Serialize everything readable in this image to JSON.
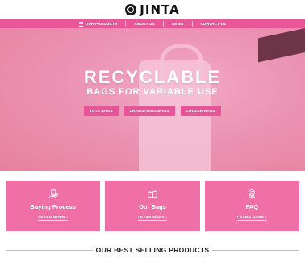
{
  "brand": {
    "logo_text": "JINTA"
  },
  "nav": {
    "items": [
      {
        "label": "OUR PRODUCTS"
      },
      {
        "label": "ABOUT US"
      },
      {
        "label": "NEWS"
      },
      {
        "label": "CONTACT US"
      }
    ]
  },
  "hero": {
    "title": "RECYCLABLE",
    "subtitle": "BAGS FOR VARIABLE USE",
    "buttons": [
      {
        "label": "TOTE BAGS"
      },
      {
        "label": "DRAWSTRING BAGS"
      },
      {
        "label": "COOLER BAGS"
      }
    ]
  },
  "cards": [
    {
      "title": "Buying Process",
      "link": "LEARN MORE  ›",
      "icon": "hand-bag-icon"
    },
    {
      "title": "Our Bags",
      "link": "LEARN MORE  ›",
      "icon": "bags-icon"
    },
    {
      "title": "FAQ",
      "link": "LEARN MORE  ›",
      "icon": "badge-icon"
    }
  ],
  "section": {
    "title": "OUR BEST SELLING PRODUCTS"
  },
  "colors": {
    "accent": "#e9569a",
    "card": "#ef6fa6",
    "hero_bg": "#eb93b3"
  }
}
